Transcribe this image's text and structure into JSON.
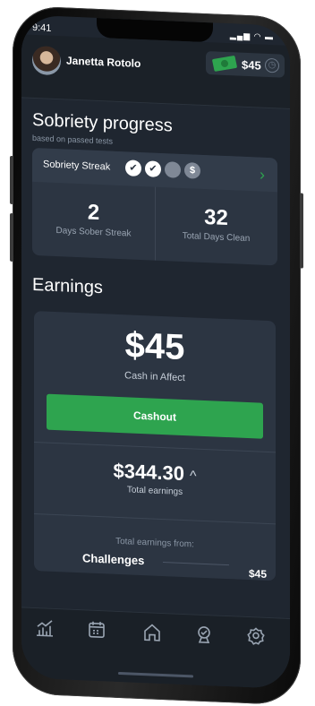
{
  "status": {
    "time": "9:41",
    "icons": "▂▄▆ ◠ ▬"
  },
  "user": {
    "name": "Janetta Rotolo"
  },
  "balance": {
    "amount": "$45"
  },
  "sobriety": {
    "title": "Sobriety progress",
    "subtitle": "based on passed tests",
    "streak_label": "Sobriety Streak",
    "streak_marks": [
      "✔",
      "✔",
      "",
      "$"
    ],
    "stats": [
      {
        "value": "2",
        "label": "Days Sober Streak"
      },
      {
        "value": "32",
        "label": "Total Days Clean"
      }
    ]
  },
  "earnings": {
    "title": "Earnings",
    "cash_amount": "$45",
    "cash_label": "Cash in Affect",
    "cashout_label": "Cashout",
    "total_amount": "$344.30",
    "total_chevron": "^",
    "total_label": "Total earnings",
    "from_label": "Total earnings from:",
    "challenges_label": "Challenges",
    "challenges_amount": "$45"
  },
  "tabbar": {
    "items": [
      {
        "icon": "chart-icon"
      },
      {
        "icon": "calendar-icon"
      },
      {
        "icon": "home-icon"
      },
      {
        "icon": "trophy-icon"
      },
      {
        "icon": "settings-icon"
      }
    ]
  },
  "colors": {
    "accent": "#2ea44f",
    "background": "#1f2630",
    "card": "#2c3542"
  }
}
